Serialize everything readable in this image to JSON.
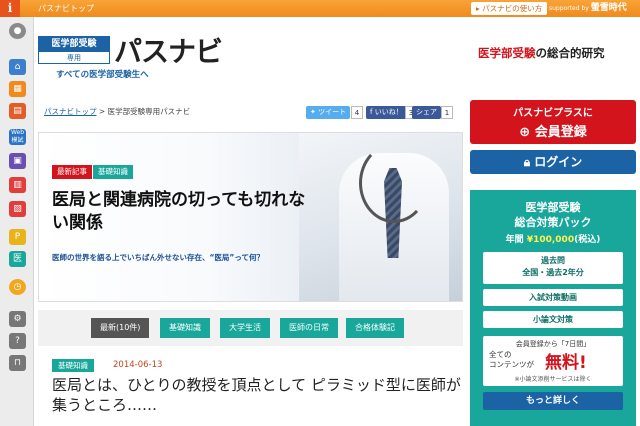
{
  "topbar": {
    "home_link": "パスナビトップ",
    "guide": "パスナビの使い方",
    "supported_by": "supported by",
    "sponsor": "螢雪時代"
  },
  "header": {
    "logo_line1": "医学部受験",
    "logo_line2": "専用",
    "logo_main": "パスナビ",
    "tagline": "すべての医学部受験生へ",
    "right_red": "医学部受験",
    "right_rest": "の総合的研究"
  },
  "breadcrumb": {
    "home": "パスナビトップ",
    "sep": ">",
    "current": "医学部受験専用パスナビ"
  },
  "share": {
    "tweet": "ツイート",
    "tweet_count": "4",
    "like": "いいね！",
    "like_count": "3",
    "share_label": "シェア",
    "share_count": "1"
  },
  "hero": {
    "badge_latest": "最新記事",
    "badge_basic": "基礎知識",
    "title": "医局と関連病院の切っても切れない関係",
    "subtitle": "医師の世界を語る上でいちばん外せない存在、“医局”って何？"
  },
  "tabs": [
    {
      "label": "最新(10件)",
      "active": true
    },
    {
      "label": "基礎知識",
      "active": false
    },
    {
      "label": "大学生活",
      "active": false
    },
    {
      "label": "医師の日常",
      "active": false
    },
    {
      "label": "合格体験記",
      "active": false
    }
  ],
  "article": {
    "badge": "基礎知識",
    "date": "2014-06-13",
    "title": "医局とは、ひとりの教授を頂点として ピラミッド型に医師が集うところ……"
  },
  "right": {
    "plus_line1": "パスナビプラスに",
    "plus_line2": "会員登録",
    "login": "ログイン",
    "pack_title1": "医学部受験",
    "pack_title2": "総合対策パック",
    "pack_price_prefix": "年間",
    "pack_price": "¥100,000",
    "pack_price_tax": "(税込)",
    "item1_line1": "過去問",
    "item1_line2": "全国・過去2年分",
    "item2": "入試対策動画",
    "item3": "小論文対策",
    "free_top": "会員登録から「7日間」",
    "free_left1": "全ての",
    "free_left2": "コンテンツが",
    "free_big": "無料!",
    "free_note": "※小論文添削サービスは除く",
    "more": "もっと詳しく"
  },
  "colors": {
    "accent_orange": "#f08a1e",
    "brand_blue": "#1b63a5",
    "teal": "#19a79b",
    "red": "#d4141c"
  }
}
